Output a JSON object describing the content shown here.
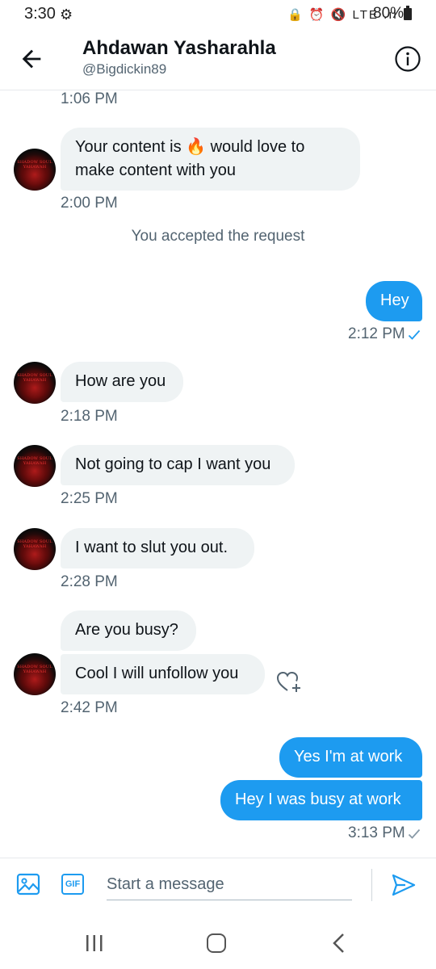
{
  "status_bar": {
    "time": "3:30",
    "icons_text": "🔒 ⏰ 🔇 LTE .ıl",
    "battery": "80%"
  },
  "header": {
    "title": "Ahdawan Yasharahla",
    "handle": "@Bigdickin89"
  },
  "avatar_label": "SHADOW SOUL YAHAWAH",
  "messages": {
    "ts_top": "1:06 PM",
    "m1_line1": "Your content is 🔥 would love to",
    "m1_line2": "make content with you",
    "ts_m1": "2:00 PM",
    "system_note": "You accepted the request",
    "m2": "Hey",
    "ts_m2": "2:12 PM",
    "m3": "How are you",
    "ts_m3": "2:18 PM",
    "m4": "Not going to cap I want you",
    "ts_m4": "2:25 PM",
    "m5": "I want to slut you out.",
    "ts_m5": "2:28 PM",
    "m6": "Are you busy?",
    "m7": "Cool I will unfollow you",
    "ts_m7": "2:42 PM",
    "m8": "Yes I'm at work",
    "m9": "Hey I was busy at work",
    "ts_m9": "3:13 PM"
  },
  "composer": {
    "gif_label": "GIF",
    "placeholder": "Start a message"
  },
  "colors": {
    "accent": "#1d9bf0",
    "bubble_in": "#eff3f4",
    "muted_text": "#536471"
  },
  "icons": [
    "gear-icon",
    "back-arrow-icon",
    "info-icon",
    "react-heart-icon",
    "image-icon",
    "gif-icon",
    "send-icon",
    "check-icon"
  ]
}
